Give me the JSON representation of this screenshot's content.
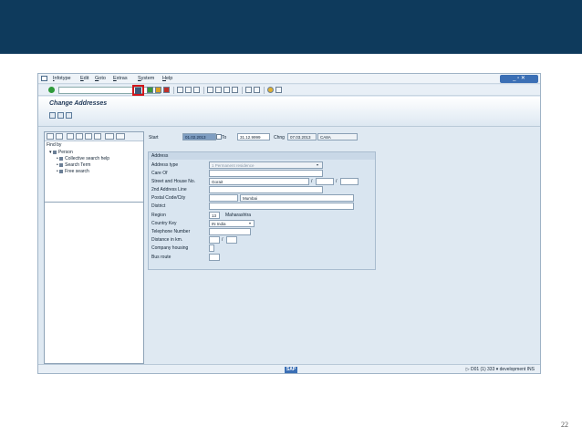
{
  "menu": [
    "Infotype",
    "Edit",
    "Goto",
    "Extras",
    "System",
    "Help"
  ],
  "window_controls": "_ ▫ ✕",
  "toolbar": {
    "dropdown_glyph": "▾",
    "back_glyph": "◁"
  },
  "page_title": "Change Addresses",
  "left_panel": {
    "find_by": "Find by",
    "tree": [
      "Person",
      "Collective search help",
      "Search Term",
      "Free search"
    ]
  },
  "header": {
    "start_label": "Start",
    "start_value": "01.02.2013",
    "to_label": "To",
    "to_value": "31.12.9999",
    "chng_label": "Chng",
    "chng_date": "07.03.2013",
    "chng_user": "CA8A"
  },
  "address": {
    "group_title": "Address",
    "labels": {
      "address_type": "Address type",
      "care_of": "Care Of",
      "street": "Street and House No.",
      "line2": "2nd Address Line",
      "postal_city": "Postal Code/City",
      "district": "District",
      "region": "Region",
      "country": "Country Key",
      "phone": "Telephone Number",
      "distance": "Distance in km.",
      "company_housing": "Company housing",
      "bus_route": "Bus route"
    },
    "values": {
      "address_type": "1 Permanent residence",
      "street": "Gorait",
      "city": "Mumbai",
      "region_code": "13",
      "region_name": "Maharashtra",
      "country": "IN India"
    },
    "slash": "/"
  },
  "status": {
    "logo": "SAP",
    "info": "▷ D01 (1) 333 ▾ development INS"
  },
  "slide_number": "22",
  "colors": {
    "banner": "#0e3a5c",
    "highlight": "#d0161c",
    "panel": "#dfe9f2"
  }
}
